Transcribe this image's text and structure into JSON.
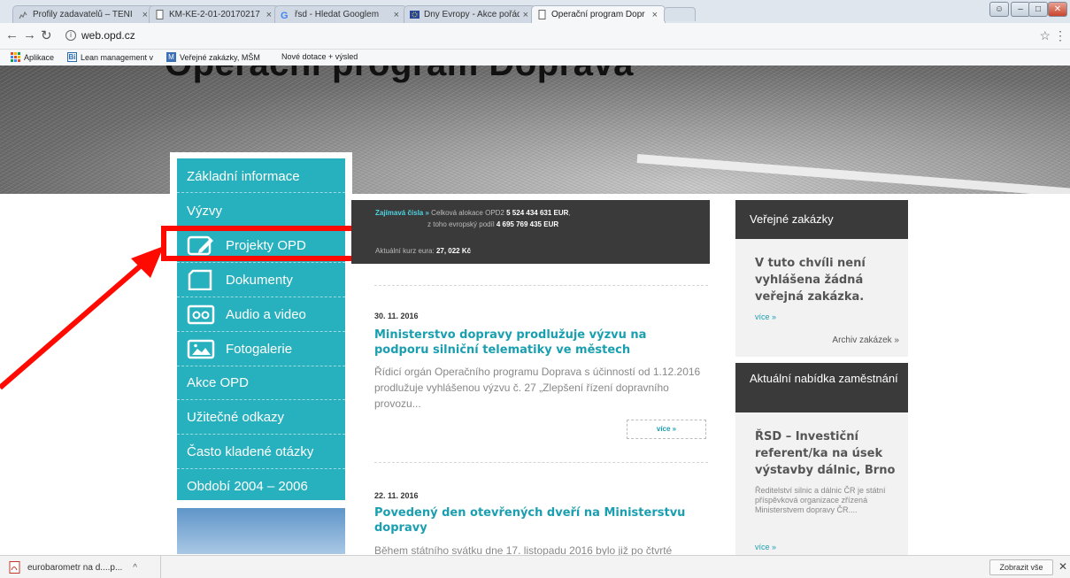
{
  "browser": {
    "tabs": [
      {
        "label": "Profily zadavatelů – TENI",
        "icon": "signal-icon"
      },
      {
        "label": "KM-KE-2-01-20170217",
        "icon": "page-icon"
      },
      {
        "label": "řsd - Hledat Googlem",
        "icon": "google-icon"
      },
      {
        "label": "Dny Evropy - Akce pořád",
        "icon": "eu-flag-icon"
      },
      {
        "label": "Operační program Dopr",
        "icon": "page-icon"
      }
    ],
    "url": "web.opd.cz",
    "bookmarks": [
      {
        "label": "Aplikace",
        "icon": "apps-grid-icon"
      },
      {
        "label": "Lean management v",
        "icon": "bi-icon"
      },
      {
        "label": "Veřejné zakázky, MŠM",
        "icon": "gmail-icon"
      },
      {
        "label": "Nové dotace + výsled",
        "icon": "none"
      }
    ]
  },
  "page": {
    "header_title": "Operační program Doprava",
    "sidebar": [
      {
        "label": "Základní informace",
        "icon": "none"
      },
      {
        "label": "Výzvy",
        "icon": "none"
      },
      {
        "label": "Projekty OPD",
        "icon": "edit-document-icon"
      },
      {
        "label": "Dokumenty",
        "icon": "document-icon"
      },
      {
        "label": "Audio a video",
        "icon": "cassette-icon"
      },
      {
        "label": "Fotogalerie",
        "icon": "photo-icon"
      },
      {
        "label": "Akce OPD",
        "icon": "none"
      },
      {
        "label": "Užitečné odkazy",
        "icon": "none"
      },
      {
        "label": "Často kladené otázky",
        "icon": "none"
      },
      {
        "label": "Období 2004 – 2006",
        "icon": "none"
      }
    ],
    "facts": {
      "label": "Zajímavá čísla »",
      "allocation_prefix": "Celková alokace OPD2",
      "allocation_value": "5 524 434 631 EUR",
      "eu_prefix": "z toho evropský podíl",
      "eu_value": "4 695 769 435 EUR",
      "rate_prefix": "Aktuální kurz eura:",
      "rate_value": "27, 022 Kč"
    },
    "news": [
      {
        "date": "30. 11. 2016",
        "title": "Ministerstvo dopravy prodlužuje výzvu na podporu silniční telematiky ve městech",
        "body": "Řídicí orgán Operačního programu Doprava s účinností od 1.12.2016 prodlužuje vyhlášenou výzvu č. 27 „Zlepšení řízení dopravního provozu...",
        "more": "více »"
      },
      {
        "date": "22. 11. 2016",
        "title": "Povedený den otevřených dveří na Ministerstvu dopravy",
        "body": "Během státního svátku dne 17. listopadu 2016 bylo již po čtvrté"
      }
    ],
    "tenders": {
      "heading": "Veřejné zakázky",
      "text": "V tuto chvíli není vyhlášena žádná veřejná zakázka.",
      "more": "více »",
      "archive": "Archiv zakázek »"
    },
    "jobs": {
      "heading": "Aktuální nabídka zaměstnání",
      "title": "ŘSD – Investiční referent/ka na úsek výstavby dálnic, Brno",
      "desc": "Ředitelství silnic a dálnic ČR je státní příspěvková organizace zřízená Ministerstvem dopravy ČR....",
      "more": "více »"
    }
  },
  "downloads": {
    "file": "eurobarometr na d....p...",
    "show_all": "Zobrazit vše"
  },
  "annotation": {
    "color": "#ff0a00"
  },
  "colors": {
    "sidebar": "#27b0bd",
    "accent": "#1a9fb0",
    "dark": "#3a3a3a"
  }
}
